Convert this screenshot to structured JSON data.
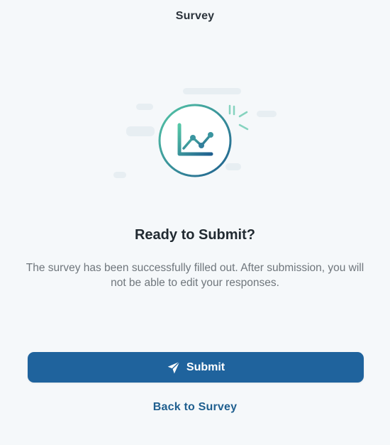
{
  "header": {
    "title": "Survey"
  },
  "illustration": {
    "icon": "chart-icon",
    "gradient_start": "#52c1a4",
    "gradient_end": "#1f5f8f"
  },
  "content": {
    "heading": "Ready to Submit?",
    "description": "The survey has been successfully filled out. After submission, you will not be able to edit your responses."
  },
  "actions": {
    "submit_label": "Submit",
    "submit_icon": "send-icon",
    "back_label": "Back to Survey"
  },
  "colors": {
    "primary": "#1f639d",
    "link": "#1f5f8f",
    "background": "#f5f8fa"
  }
}
